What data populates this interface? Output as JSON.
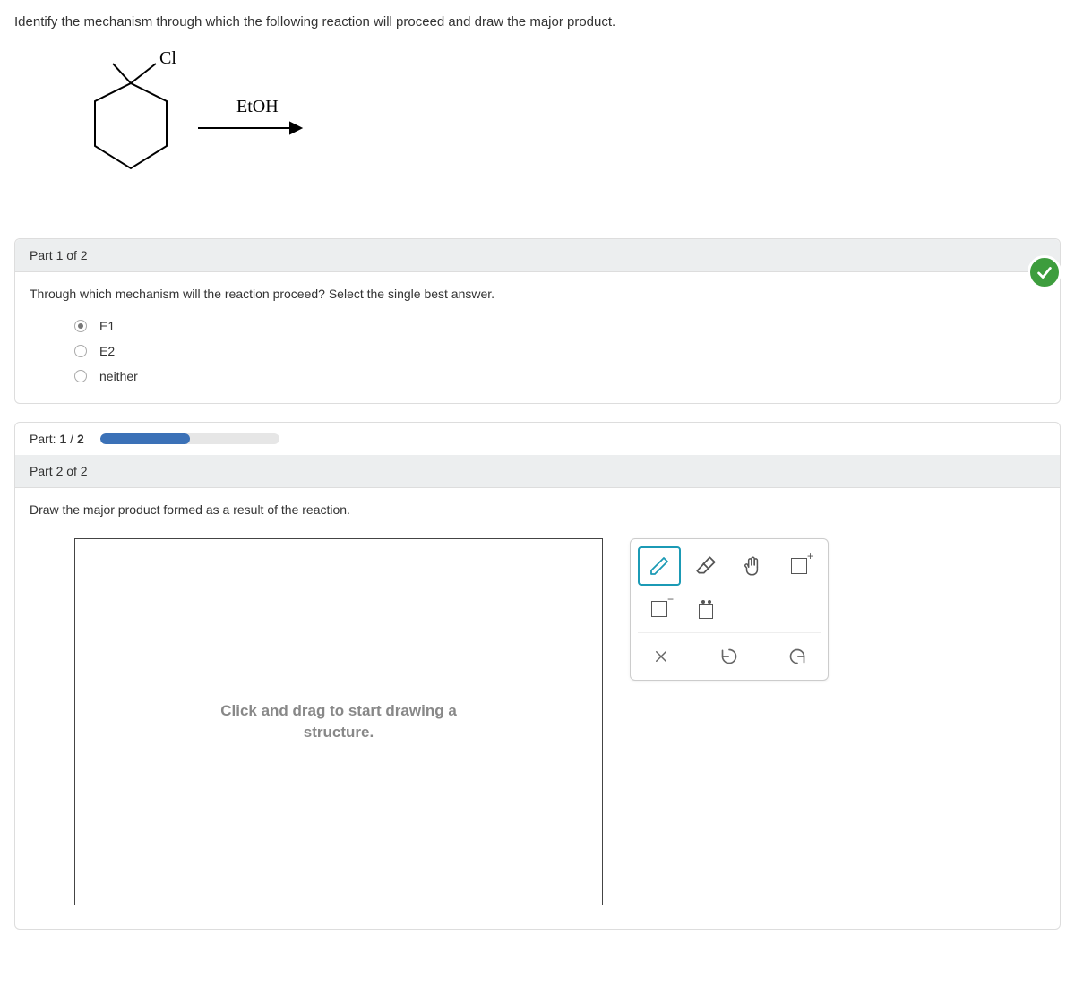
{
  "question_text": "Identify the mechanism through which the following reaction will proceed and draw the major product.",
  "reaction": {
    "substrate_label": "Cl",
    "reagent_label": "EtOH"
  },
  "part1": {
    "header": "Part 1 of 2",
    "prompt": "Through which mechanism will the reaction proceed? Select the single best answer.",
    "options": [
      "E1",
      "E2",
      "neither"
    ],
    "selected_index": 0,
    "correct": true
  },
  "progress": {
    "label_prefix": "Part: ",
    "current": "1",
    "total": "2",
    "percent": 50
  },
  "part2": {
    "header": "Part 2 of 2",
    "prompt": "Draw the major product formed as a result of the reaction.",
    "canvas_placeholder": "Click and drag to start drawing a structure."
  },
  "tools": {
    "pencil": "pencil-icon",
    "eraser": "eraser-icon",
    "hand": "hand-icon",
    "boxplus": "+",
    "boxminus": "−",
    "lonepair": "lone-pair",
    "clear": "×",
    "undo": "undo",
    "redo": "redo"
  }
}
